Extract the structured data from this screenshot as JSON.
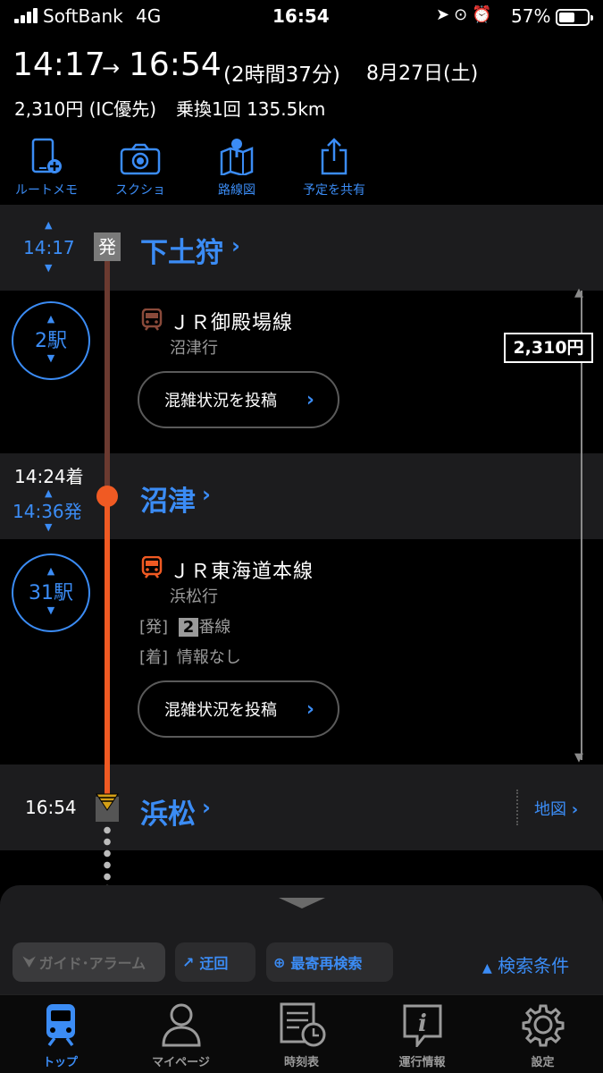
{
  "status_bar": {
    "carrier": "SoftBank",
    "network": "4G",
    "time": "16:54",
    "battery_percent": "57%"
  },
  "summary": {
    "depart_time": "14:17",
    "arrow": "→",
    "arrive_time": "16:54",
    "duration": "(2時間37分)",
    "date": "8月27日(土)",
    "fare": "2,310円 (IC優先)",
    "transfers_distance": "乗換1回 135.5km"
  },
  "actions": [
    {
      "label": "ルートメモ",
      "icon": "phone-plus-icon"
    },
    {
      "label": "スクショ",
      "icon": "camera-icon"
    },
    {
      "label": "路線図",
      "icon": "route-map-icon"
    },
    {
      "label": "予定を共有",
      "icon": "share-icon"
    }
  ],
  "route": {
    "origin": {
      "time": "14:17",
      "badge": "発",
      "name": "下土狩"
    },
    "segment1": {
      "stops": "2駅",
      "line": "ＪＲ御殿場線",
      "destination": "沼津行",
      "crowd_button": "混雑状況を投稿",
      "fare_badge": "2,310円",
      "line_color": "#6b3a30"
    },
    "transfer": {
      "arrive_time": "14:24着",
      "depart_time": "14:36発",
      "name": "沼津"
    },
    "segment2": {
      "stops": "31駅",
      "line": "ＪＲ東海道本線",
      "destination": "浜松行",
      "dep_label": "[発]",
      "platform_number": "2",
      "platform_suffix": "番線",
      "arr_label": "[着]",
      "arr_info": "情報なし",
      "crowd_button": "混雑状況を投稿",
      "line_color": "#f05a23"
    },
    "destination": {
      "time": "16:54",
      "name": "浜松",
      "map_link": "地図"
    }
  },
  "bottom_panel": {
    "guide_alarm": "ガイド･アラーム",
    "detour": "迂回",
    "nearest_research": "最寄再検索",
    "search_conditions": "検索条件"
  },
  "tabs": [
    {
      "label": "トップ",
      "icon": "train-icon",
      "active": true
    },
    {
      "label": "マイページ",
      "icon": "person-icon",
      "active": false
    },
    {
      "label": "時刻表",
      "icon": "timetable-icon",
      "active": false
    },
    {
      "label": "運行情報",
      "icon": "info-icon",
      "active": false
    },
    {
      "label": "設定",
      "icon": "gear-icon",
      "active": false
    }
  ],
  "colors": {
    "accent": "#3b8cf5",
    "row_bg": "#1c1c1e",
    "text_secondary": "#9a9a9a"
  }
}
